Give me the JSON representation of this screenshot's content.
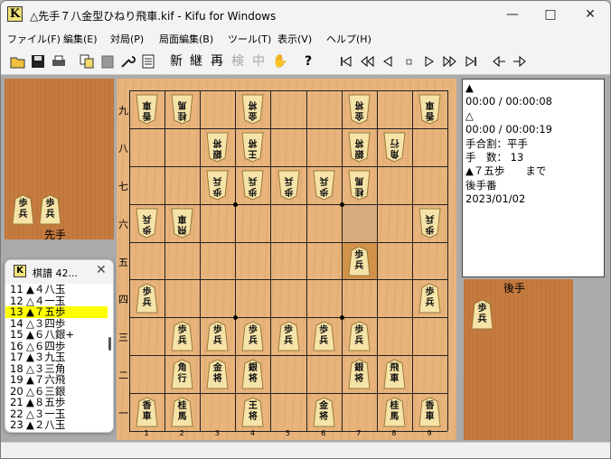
{
  "window": {
    "title": "△先手７八金型ひねり飛車.kif - Kifu for Windows",
    "icon_letter": "K",
    "controls": [
      "minimize-icon",
      "maximize-icon",
      "close-icon"
    ]
  },
  "menu": [
    "ファイル(F)",
    "編集(E)",
    "対局(P)",
    "局面編集(B)",
    "ツール(T)",
    "表示(V)",
    "ヘルプ(H)"
  ],
  "toolbar": {
    "kanji_buttons": [
      "新",
      "継",
      "再",
      "検",
      "中"
    ],
    "nav_icons": [
      "first-icon",
      "back-5-icon",
      "back-icon",
      "stop-icon",
      "forward-icon",
      "forward-5-icon",
      "last-icon",
      "branch-back-icon",
      "branch-forward-icon"
    ]
  },
  "board": {
    "rank_labels": [
      "九",
      "八",
      "七",
      "六",
      "五",
      "四",
      "三",
      "二",
      "一"
    ],
    "file_labels": [
      "1",
      "2",
      "3",
      "4",
      "5",
      "6",
      "7",
      "8",
      "9"
    ],
    "last_move_square": "7五",
    "pieces": [
      {
        "col": 0,
        "row": 0,
        "t1": "香",
        "t2": "車",
        "side": "gote"
      },
      {
        "col": 1,
        "row": 0,
        "t1": "桂",
        "t2": "馬",
        "side": "gote"
      },
      {
        "col": 3,
        "row": 0,
        "t1": "金",
        "t2": "将",
        "side": "gote"
      },
      {
        "col": 6,
        "row": 0,
        "t1": "金",
        "t2": "将",
        "side": "gote"
      },
      {
        "col": 8,
        "row": 0,
        "t1": "香",
        "t2": "車",
        "side": "gote"
      },
      {
        "col": 2,
        "row": 1,
        "t1": "銀",
        "t2": "将",
        "side": "gote"
      },
      {
        "col": 3,
        "row": 1,
        "t1": "王",
        "t2": "将",
        "side": "gote"
      },
      {
        "col": 6,
        "row": 1,
        "t1": "銀",
        "t2": "将",
        "side": "gote"
      },
      {
        "col": 7,
        "row": 1,
        "t1": "角",
        "t2": "行",
        "side": "gote"
      },
      {
        "col": 2,
        "row": 2,
        "t1": "歩",
        "t2": "兵",
        "side": "gote"
      },
      {
        "col": 3,
        "row": 2,
        "t1": "歩",
        "t2": "兵",
        "side": "gote"
      },
      {
        "col": 4,
        "row": 2,
        "t1": "歩",
        "t2": "兵",
        "side": "gote"
      },
      {
        "col": 5,
        "row": 2,
        "t1": "歩",
        "t2": "兵",
        "side": "gote"
      },
      {
        "col": 6,
        "row": 2,
        "t1": "桂",
        "t2": "馬",
        "side": "gote"
      },
      {
        "col": 0,
        "row": 3,
        "t1": "歩",
        "t2": "兵",
        "side": "gote"
      },
      {
        "col": 1,
        "row": 3,
        "t1": "飛",
        "t2": "車",
        "side": "gote"
      },
      {
        "col": 8,
        "row": 3,
        "t1": "歩",
        "t2": "兵",
        "side": "gote"
      },
      {
        "col": 6,
        "row": 4,
        "t1": "歩",
        "t2": "兵",
        "side": "sente"
      },
      {
        "col": 0,
        "row": 5,
        "t1": "歩",
        "t2": "兵",
        "side": "sente"
      },
      {
        "col": 8,
        "row": 5,
        "t1": "歩",
        "t2": "兵",
        "side": "sente"
      },
      {
        "col": 1,
        "row": 6,
        "t1": "歩",
        "t2": "兵",
        "side": "sente"
      },
      {
        "col": 2,
        "row": 6,
        "t1": "歩",
        "t2": "兵",
        "side": "sente"
      },
      {
        "col": 3,
        "row": 6,
        "t1": "歩",
        "t2": "兵",
        "side": "sente"
      },
      {
        "col": 4,
        "row": 6,
        "t1": "歩",
        "t2": "兵",
        "side": "sente"
      },
      {
        "col": 5,
        "row": 6,
        "t1": "歩",
        "t2": "兵",
        "side": "sente"
      },
      {
        "col": 6,
        "row": 6,
        "t1": "歩",
        "t2": "兵",
        "side": "sente"
      },
      {
        "col": 1,
        "row": 7,
        "t1": "角",
        "t2": "行",
        "side": "sente"
      },
      {
        "col": 2,
        "row": 7,
        "t1": "金",
        "t2": "将",
        "side": "sente"
      },
      {
        "col": 3,
        "row": 7,
        "t1": "銀",
        "t2": "将",
        "side": "sente"
      },
      {
        "col": 6,
        "row": 7,
        "t1": "銀",
        "t2": "将",
        "side": "sente"
      },
      {
        "col": 7,
        "row": 7,
        "t1": "飛",
        "t2": "車",
        "side": "sente"
      },
      {
        "col": 0,
        "row": 8,
        "t1": "香",
        "t2": "車",
        "side": "sente"
      },
      {
        "col": 1,
        "row": 8,
        "t1": "桂",
        "t2": "馬",
        "side": "sente"
      },
      {
        "col": 3,
        "row": 8,
        "t1": "王",
        "t2": "将",
        "side": "sente"
      },
      {
        "col": 5,
        "row": 8,
        "t1": "金",
        "t2": "将",
        "side": "sente"
      },
      {
        "col": 7,
        "row": 8,
        "t1": "桂",
        "t2": "馬",
        "side": "sente"
      },
      {
        "col": 8,
        "row": 8,
        "t1": "香",
        "t2": "車",
        "side": "sente"
      }
    ]
  },
  "hands": {
    "sente_label": "先手",
    "gote_label": "後手",
    "sente_pieces": [
      {
        "t1": "歩",
        "t2": "兵"
      },
      {
        "t1": "歩",
        "t2": "兵"
      }
    ],
    "gote_pieces": [
      {
        "t1": "歩",
        "t2": "兵"
      }
    ]
  },
  "info": {
    "lines": [
      "▲",
      "00:00 / 00:00:08",
      "△",
      "00:00 / 00:00:19",
      "手合割：平手",
      "手　数： 13",
      "▲７五歩　　まで",
      "後手番",
      "2023/01/02"
    ]
  },
  "kifu": {
    "title": "棋譜 42...",
    "rows": [
      {
        "n": "11",
        "move": "▲４八玉"
      },
      {
        "n": "12",
        "move": "△４一玉"
      },
      {
        "n": "13",
        "move": "▲７五歩"
      },
      {
        "n": "14",
        "move": "△３四歩"
      },
      {
        "n": "15",
        "move": "▲６八銀+"
      },
      {
        "n": "16",
        "move": "△６四歩"
      },
      {
        "n": "17",
        "move": "▲３九玉"
      },
      {
        "n": "18",
        "move": "△３三角"
      },
      {
        "n": "19",
        "move": "▲７六飛"
      },
      {
        "n": "20",
        "move": "△６三銀"
      },
      {
        "n": "21",
        "move": "▲８五歩"
      },
      {
        "n": "22",
        "move": "△３一玉"
      },
      {
        "n": "23",
        "move": "▲２八玉"
      }
    ],
    "selected_index": 2
  }
}
